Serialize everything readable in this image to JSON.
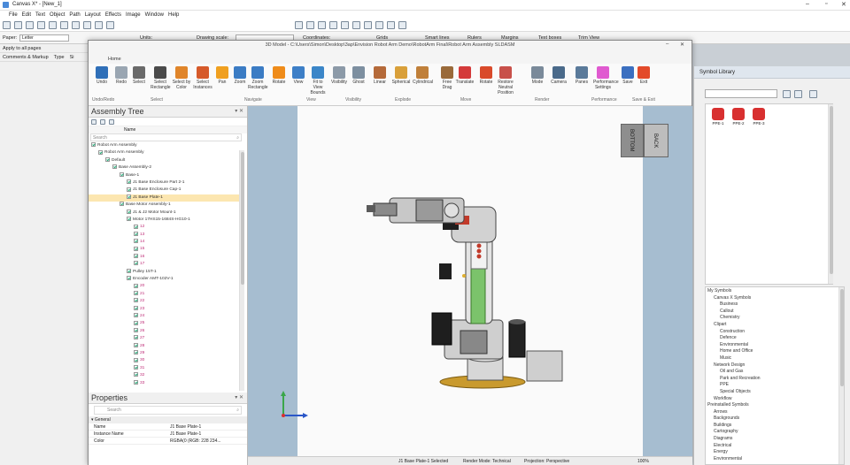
{
  "app": {
    "title": "Canvas X* - [New_1]",
    "menu": [
      "File",
      "Edit",
      "Text",
      "Object",
      "Path",
      "Layout",
      "Effects",
      "Image",
      "Window",
      "Help"
    ]
  },
  "propbar": {
    "paper_label": "Paper:",
    "paper_value": "Letter",
    "units_label": "Units:",
    "drawing_scale_label": "Drawing scale:",
    "coordinates_label": "Coordinates:",
    "apply_all_pages": "Apply to all pages",
    "toggles": [
      "Grids",
      "Smart lines",
      "Rulers",
      "Margins",
      "Text boxes",
      "Trim View"
    ]
  },
  "leftdoc": {
    "tabs": [
      "Comments & Markup",
      "Type",
      "Si"
    ]
  },
  "win3d": {
    "title": "3D Model - C:\\Users\\Simon\\Desktop\\3ap\\Envision Robot Arm Demo\\RobotArm Final\\Robot Arm Assembly SLDASM",
    "home_tab": "Home",
    "ribbon": [
      {
        "label": "Undo",
        "icon": "undo-icon",
        "color": "#2f6fb8"
      },
      {
        "label": "Redo",
        "icon": "redo-icon",
        "color": "#9aa6b2"
      },
      {
        "label": "Select",
        "icon": "select-arrow-icon",
        "color": "#6a6a6a"
      },
      {
        "label": "Select Rectangle",
        "icon": "select-rectangle-icon",
        "color": "#4a4a4a"
      },
      {
        "label": "Select by Color",
        "icon": "select-by-color-icon",
        "color": "#e0852a"
      },
      {
        "label": "Select Instances",
        "icon": "select-instances-icon",
        "color": "#d65a2a"
      },
      {
        "label": "Pan",
        "icon": "pan-icon",
        "color": "#f0a020"
      },
      {
        "label": "Zoom",
        "icon": "zoom-icon",
        "color": "#3b7cc4"
      },
      {
        "label": "Zoom Rectangle",
        "icon": "zoom-rectangle-icon",
        "color": "#3b7cc4"
      },
      {
        "label": "Rotate",
        "icon": "rotate-icon",
        "color": "#ef8c1a"
      },
      {
        "label": "View",
        "icon": "view-cube-icon",
        "color": "#3d7fc7"
      },
      {
        "label": "Fit to View Bounds",
        "icon": "fit-to-view-icon",
        "color": "#3b86c8"
      },
      {
        "label": "Visibility",
        "icon": "visibility-icon",
        "color": "#8c9aa8"
      },
      {
        "label": "Ghost",
        "icon": "ghost-icon",
        "color": "#7d8fa0"
      },
      {
        "label": "Linear",
        "icon": "explode-linear-icon",
        "color": "#b56a3a"
      },
      {
        "label": "Spherical",
        "icon": "explode-spherical-icon",
        "color": "#d9a03a"
      },
      {
        "label": "Cylindrical",
        "icon": "explode-cylindrical-icon",
        "color": "#c0803a"
      },
      {
        "label": "Free Drag",
        "icon": "free-drag-icon",
        "color": "#9a6a3a"
      },
      {
        "label": "Translate",
        "icon": "translate-icon",
        "color": "#d43a3a"
      },
      {
        "label": "Rotate",
        "icon": "move-rotate-icon",
        "color": "#d94a2a"
      },
      {
        "label": "Restore Neutral Position",
        "icon": "restore-position-icon",
        "color": "#c8504a"
      },
      {
        "label": "Mode",
        "icon": "render-mode-icon",
        "color": "#7a8a9a"
      },
      {
        "label": "Camera",
        "icon": "camera-icon",
        "color": "#4a6a8a"
      },
      {
        "label": "Panes",
        "icon": "panes-icon",
        "color": "#5a7a9a"
      },
      {
        "label": "Performance Settings",
        "icon": "performance-icon",
        "color": "#e05ad0"
      },
      {
        "label": "Save",
        "icon": "save-icon",
        "color": "#3b6fc0"
      },
      {
        "label": "Exit",
        "icon": "exit-icon",
        "color": "#e34a2a"
      }
    ],
    "groups": [
      "Undo/Redo",
      "Select",
      "Navigate",
      "View",
      "Visibility",
      "Explode",
      "Move",
      "Render",
      "Performance",
      "Save & Exit"
    ]
  },
  "assembly": {
    "header": "Assembly Tree",
    "name_col": "Name",
    "search_placeholder": "Search",
    "rows": [
      {
        "label": "Robot Arm Assembly",
        "depth": 0,
        "sel": false
      },
      {
        "label": "Robot Arm Assembly",
        "depth": 1,
        "sel": false
      },
      {
        "label": "Default",
        "depth": 2,
        "sel": false
      },
      {
        "label": "Base Assembly-2",
        "depth": 3,
        "sel": false
      },
      {
        "label": "Base-1",
        "depth": 4,
        "sel": false
      },
      {
        "label": "J1 Base Enclosure Part 2-1",
        "depth": 5,
        "sel": false
      },
      {
        "label": "J1 Base Enclosure Cap-1",
        "depth": 5,
        "sel": false
      },
      {
        "label": "J1 Base Plate-1",
        "depth": 5,
        "sel": true
      },
      {
        "label": "Base Motor Assembly-1",
        "depth": 4,
        "sel": false
      },
      {
        "label": "J1 & J2 Motor Mount-1",
        "depth": 5,
        "sel": false
      },
      {
        "label": "Motor 17HS15-1684S-HG10-1",
        "depth": 5,
        "sel": false
      },
      {
        "label": "12",
        "depth": 6,
        "sel": false
      },
      {
        "label": "13",
        "depth": 6,
        "sel": false
      },
      {
        "label": "14",
        "depth": 6,
        "sel": false
      },
      {
        "label": "15",
        "depth": 6,
        "sel": false
      },
      {
        "label": "16",
        "depth": 6,
        "sel": false
      },
      {
        "label": "17",
        "depth": 6,
        "sel": false
      },
      {
        "label": "Pulley 15T-1",
        "depth": 5,
        "sel": false
      },
      {
        "label": "Encoder AMT-102V-1",
        "depth": 5,
        "sel": false
      },
      {
        "label": "20",
        "depth": 6,
        "sel": false
      },
      {
        "label": "21",
        "depth": 6,
        "sel": false
      },
      {
        "label": "22",
        "depth": 6,
        "sel": false
      },
      {
        "label": "23",
        "depth": 6,
        "sel": false
      },
      {
        "label": "24",
        "depth": 6,
        "sel": false
      },
      {
        "label": "25",
        "depth": 6,
        "sel": false
      },
      {
        "label": "26",
        "depth": 6,
        "sel": false
      },
      {
        "label": "27",
        "depth": 6,
        "sel": false
      },
      {
        "label": "28",
        "depth": 6,
        "sel": false
      },
      {
        "label": "29",
        "depth": 6,
        "sel": false
      },
      {
        "label": "30",
        "depth": 6,
        "sel": false
      },
      {
        "label": "31",
        "depth": 6,
        "sel": false
      },
      {
        "label": "32",
        "depth": 6,
        "sel": false
      },
      {
        "label": "33",
        "depth": 6,
        "sel": false
      }
    ]
  },
  "properties": {
    "header": "Properties",
    "search_placeholder": "Search",
    "section": "General",
    "rows": [
      {
        "k": "Name",
        "v": "J1 Base Plate-1"
      },
      {
        "k": "Instance Name",
        "v": "J1 Base Plate-1"
      },
      {
        "k": "Color",
        "v": "RGBA(0 (RGB: 228 234..."
      }
    ]
  },
  "navcube": {
    "front": "BOTTOM",
    "side": "BACK"
  },
  "status3d": {
    "selected": "J1 Base Plate-1 Selected",
    "render_mode": "Render Mode: Technical",
    "projection": "Projection: Perspective",
    "zoom": "100%"
  },
  "symlib": {
    "header": "Symbol Library",
    "symbols": [
      "PPE-1",
      "PPE-2",
      "PPE-3"
    ],
    "tree": [
      {
        "label": "My Symbols",
        "depth": 0
      },
      {
        "label": "Canvas X Symbols",
        "depth": 1
      },
      {
        "label": "Business",
        "depth": 2
      },
      {
        "label": "Callout",
        "depth": 2
      },
      {
        "label": "Chemistry",
        "depth": 2
      },
      {
        "label": "Clipart",
        "depth": 1
      },
      {
        "label": "Construction",
        "depth": 2
      },
      {
        "label": "Defence",
        "depth": 2
      },
      {
        "label": "Environmental",
        "depth": 2
      },
      {
        "label": "Home and Office",
        "depth": 2
      },
      {
        "label": "Music",
        "depth": 2
      },
      {
        "label": "Network Design",
        "depth": 1
      },
      {
        "label": "Oil and Gas",
        "depth": 2
      },
      {
        "label": "Park and Recreation",
        "depth": 2
      },
      {
        "label": "PPE",
        "depth": 2
      },
      {
        "label": "Special Objects",
        "depth": 2
      },
      {
        "label": "Workflow",
        "depth": 1
      },
      {
        "label": "Preinstalled Symbols",
        "depth": 0
      },
      {
        "label": "Arrows",
        "depth": 1
      },
      {
        "label": "Backgrounds",
        "depth": 1
      },
      {
        "label": "Buildings",
        "depth": 1
      },
      {
        "label": "Cartography",
        "depth": 1
      },
      {
        "label": "Diagrams",
        "depth": 1
      },
      {
        "label": "Electrical",
        "depth": 1
      },
      {
        "label": "Energy",
        "depth": 1
      },
      {
        "label": "Environmental",
        "depth": 1
      }
    ]
  }
}
